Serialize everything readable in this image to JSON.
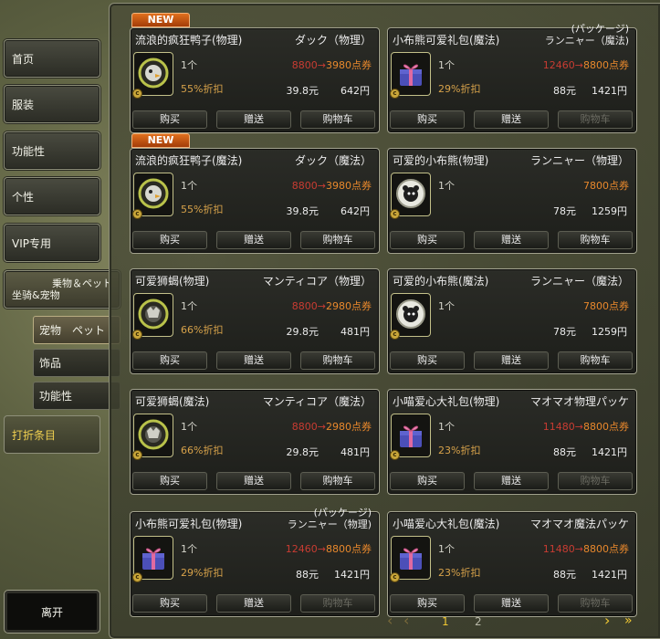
{
  "sidebar": {
    "home": "首页",
    "clothing": "服装",
    "functional": "功能性",
    "personality": "个性",
    "vip": "VIP专用",
    "mount_jp": "乗物＆ペット",
    "mount_cn": "坐骑&宠物",
    "sub_pet": "宠物　ペット",
    "sub_accessory": "饰品",
    "sub_functional": "功能性",
    "sale": "打折条目",
    "leave": "离开"
  },
  "labels": {
    "new_badge": "NEW",
    "buy": "购买",
    "gift": "赠送",
    "cart": "购物车"
  },
  "pagination": {
    "prev": "‹",
    "page1": "1",
    "page2": "2",
    "next": "›",
    "last": "»"
  },
  "items": [
    {
      "name": "流浪的疯狂鸭子(物理)",
      "jp": "ダック（物理）",
      "jp_line2": "",
      "qty": "1个",
      "price_old": "8800",
      "price_new": "3980点券",
      "price_single": "",
      "discount": "55%折扣",
      "yuan": "39.8元",
      "yen": "642円",
      "is_new": true,
      "cart_enabled": true,
      "icon": "duck-mount-icon"
    },
    {
      "name": "小布熊可爱礼包(魔法)",
      "jp": "(パッケージ)",
      "jp_line2": "ランニャー（魔法)",
      "qty": "1个",
      "price_old": "12460",
      "price_new": "8800点券",
      "price_single": "",
      "discount": "29%折扣",
      "yuan": "88元",
      "yen": "1421円",
      "is_new": false,
      "cart_enabled": false,
      "icon": "gift-box-icon"
    },
    {
      "name": "流浪的疯狂鸭子(魔法)",
      "jp": "ダック（魔法）",
      "jp_line2": "",
      "qty": "1个",
      "price_old": "8800",
      "price_new": "3980点券",
      "price_single": "",
      "discount": "55%折扣",
      "yuan": "39.8元",
      "yen": "642円",
      "is_new": true,
      "cart_enabled": true,
      "icon": "duck-mount-icon"
    },
    {
      "name": "可爱的小布熊(物理)",
      "jp": "ランニャー（物理）",
      "jp_line2": "",
      "qty": "1个",
      "price_old": "",
      "price_new": "",
      "price_single": "7800点券",
      "discount": "",
      "yuan": "78元",
      "yen": "1259円",
      "is_new": false,
      "cart_enabled": true,
      "icon": "bear-pet-icon"
    },
    {
      "name": "可爱狮蝎(物理)",
      "jp": "マンティコア（物理）",
      "jp_line2": "",
      "qty": "1个",
      "price_old": "8800",
      "price_new": "2980点券",
      "price_single": "",
      "discount": "66%折扣",
      "yuan": "29.8元",
      "yen": "481円",
      "is_new": false,
      "cart_enabled": true,
      "icon": "manticore-mount-icon"
    },
    {
      "name": "可爱的小布熊(魔法)",
      "jp": "ランニャー（魔法）",
      "jp_line2": "",
      "qty": "1个",
      "price_old": "",
      "price_new": "",
      "price_single": "7800点券",
      "discount": "",
      "yuan": "78元",
      "yen": "1259円",
      "is_new": false,
      "cart_enabled": true,
      "icon": "bear-pet-icon"
    },
    {
      "name": "可爱狮蝎(魔法)",
      "jp": "マンティコア（魔法）",
      "jp_line2": "",
      "qty": "1个",
      "price_old": "8800",
      "price_new": "2980点券",
      "price_single": "",
      "discount": "66%折扣",
      "yuan": "29.8元",
      "yen": "481円",
      "is_new": false,
      "cart_enabled": true,
      "icon": "manticore-mount-icon"
    },
    {
      "name": "小喵爱心大礼包(物理)",
      "jp": "マオマオ物理パッケ",
      "jp_line2": "",
      "qty": "1个",
      "price_old": "11480",
      "price_new": "8800点券",
      "price_single": "",
      "discount": "23%折扣",
      "yuan": "88元",
      "yen": "1421円",
      "is_new": false,
      "cart_enabled": false,
      "icon": "gift-box-icon"
    },
    {
      "name": "小布熊可爱礼包(物理)",
      "jp": "(パッケージ)",
      "jp_line2": "ランニャー（物理)",
      "qty": "1个",
      "price_old": "12460",
      "price_new": "8800点券",
      "price_single": "",
      "discount": "29%折扣",
      "yuan": "88元",
      "yen": "1421円",
      "is_new": false,
      "cart_enabled": false,
      "icon": "gift-box-icon"
    },
    {
      "name": "小喵爱心大礼包(魔法)",
      "jp": "マオマオ魔法パッケ",
      "jp_line2": "",
      "qty": "1个",
      "price_old": "11480",
      "price_new": "8800点券",
      "price_single": "",
      "discount": "23%折扣",
      "yuan": "88元",
      "yen": "1421円",
      "is_new": false,
      "cart_enabled": false,
      "icon": "gift-box-icon"
    }
  ]
}
